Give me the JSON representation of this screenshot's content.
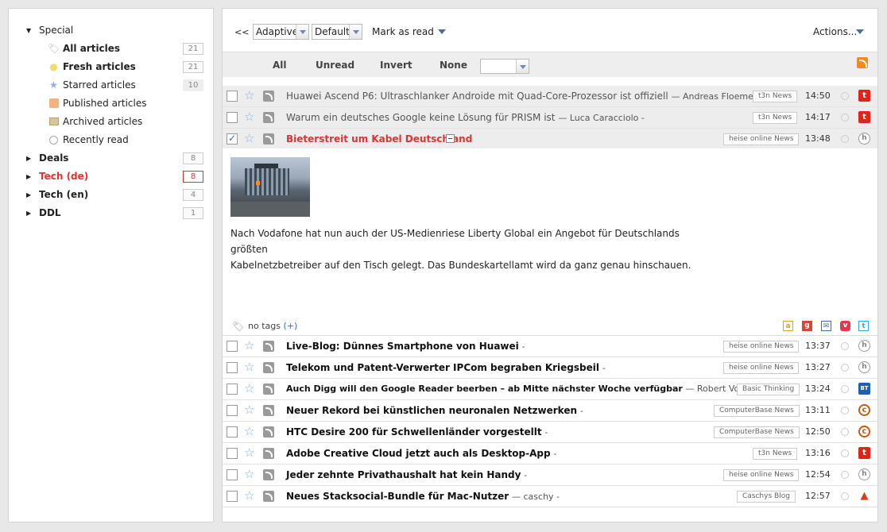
{
  "sidebar": {
    "special_label": "Special",
    "special_items": [
      {
        "label": "All articles",
        "count": "21",
        "icon": "tag-icon",
        "bold": true
      },
      {
        "label": "Fresh articles",
        "count": "21",
        "icon": "lightbulb-icon",
        "bold": true
      },
      {
        "label": "Starred articles",
        "count": "10",
        "icon": "star-icon",
        "bold": false
      },
      {
        "label": "Published articles",
        "count": "",
        "icon": "rss-icon",
        "bold": false
      },
      {
        "label": "Archived articles",
        "count": "",
        "icon": "archive-icon",
        "bold": false
      },
      {
        "label": "Recently read",
        "count": "",
        "icon": "clock-icon",
        "bold": false
      }
    ],
    "categories": [
      {
        "label": "Deals",
        "count": "8"
      },
      {
        "label": "Tech (de)",
        "count": "8"
      },
      {
        "label": "Tech (en)",
        "count": "4"
      },
      {
        "label": "DDL",
        "count": "1"
      }
    ]
  },
  "toolbar": {
    "collapse_label": "<<",
    "view_mode": "Adaptive",
    "order": "Default",
    "mark_as_read": "Mark as read",
    "actions": "Actions..."
  },
  "selection": {
    "all": "All",
    "unread": "Unread",
    "invert": "Invert",
    "none": "None",
    "select_value": ""
  },
  "headlines_top": [
    {
      "title": "Huawei Ascend P6: Ultraschlanker Androide mit Quad-Core-Prozessor ist offiziell",
      "author": "— Andreas Floemer -",
      "feed": "t3n News",
      "time": "14:50",
      "source": "t3n"
    },
    {
      "title": "Warum ein deutsches Google keine Lösung für PRISM ist",
      "author": "— Luca Caracciolo -",
      "feed": "t3n News",
      "time": "14:17",
      "source": "t3n"
    }
  ],
  "active_article": {
    "title": "Bieterstreit um Kabel Deutschland",
    "feed": "heise online News",
    "time": "13:48",
    "body_line1": "Nach Vodafone hat nun auch der US-Medienriese Liberty Global ein Angebot für Deutschlands größten",
    "body_line2": "Kabelnetzbetreiber auf den Tisch gelegt. Das Bundeskartellamt wird da ganz genau hinschauen.",
    "tags_label": "no tags",
    "tags_add": "(+)"
  },
  "headlines_bottom": [
    {
      "title": "Live-Blog: Dünnes Smartphone von Huawei",
      "author": "-",
      "feed": "heise online News",
      "time": "13:37",
      "source": "heise"
    },
    {
      "title": "Telekom und Patent-Verwerter IPCom begraben Kriegsbeil",
      "author": "-",
      "feed": "heise online News",
      "time": "13:27",
      "source": "heise"
    },
    {
      "title": "Auch Digg will den Google Reader beerben – ab Mitte nächster Woche verfügbar",
      "author": "— Robert Vossen -",
      "feed": "Basic Thinking",
      "time": "13:24",
      "source": "bt"
    },
    {
      "title": "Neuer Rekord bei künstlichen neuronalen Netzwerken",
      "author": "-",
      "feed": "ComputerBase News",
      "time": "13:11",
      "source": "cb"
    },
    {
      "title": "HTC Desire 200 für Schwellenländer vorgestellt",
      "author": "-",
      "feed": "ComputerBase News",
      "time": "12:50",
      "source": "cb"
    },
    {
      "title": "Adobe Creative Cloud jetzt auch als Desktop-App",
      "author": "-",
      "feed": "t3n News",
      "time": "13:16",
      "source": "t3n"
    },
    {
      "title": "Jeder zehnte Privathaushalt hat kein Handy",
      "author": "-",
      "feed": "heise online News",
      "time": "12:54",
      "source": "heise"
    },
    {
      "title": "Neues Stacksocial-Bundle für Mac-Nutzer",
      "author": "— caschy -",
      "feed": "Caschys Blog",
      "time": "12:57",
      "source": "caschy"
    }
  ]
}
